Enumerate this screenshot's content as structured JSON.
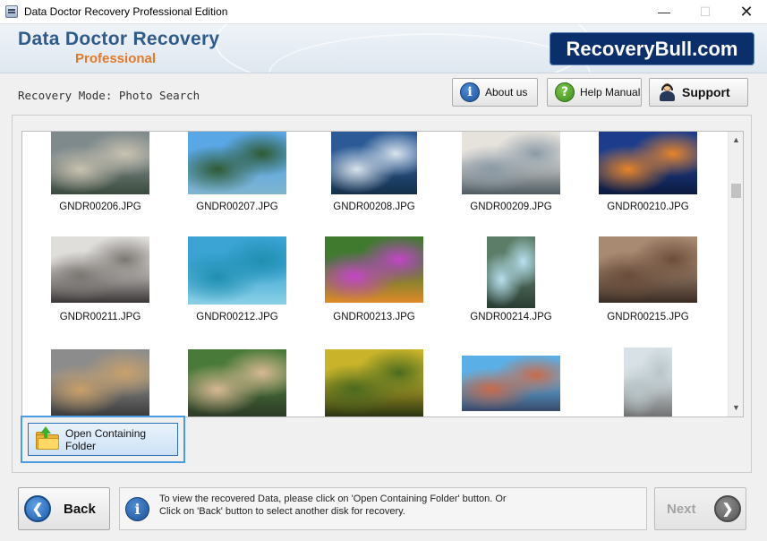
{
  "window": {
    "title": "Data Doctor Recovery Professional Edition",
    "minimize_glyph": "—",
    "maximize_glyph": "☐",
    "close_glyph": "✕"
  },
  "header": {
    "brand_name": "Data Doctor Recovery",
    "brand_edition": "Professional",
    "badge": "RecoveryBull.com"
  },
  "mode_bar": {
    "mode_label": "Recovery Mode: Photo Search",
    "about_label": "About us",
    "about_icon_glyph": "i",
    "help_label": "Help Manual",
    "help_icon_glyph": "?",
    "support_label": "Support"
  },
  "gallery": {
    "photos": [
      {
        "name": "GNDR00206.JPG",
        "icon": "family-lake-photo",
        "colors": [
          "#7e8a8c",
          "#c9c2b0",
          "#3a4a3d"
        ]
      },
      {
        "name": "GNDR00207.JPG",
        "icon": "lake-forest-photo",
        "colors": [
          "#5aa7e6",
          "#2f5a33",
          "#7fb4d0"
        ]
      },
      {
        "name": "GNDR00208.JPG",
        "icon": "winter-lake-photo",
        "colors": [
          "#2b5a96",
          "#d9e3ec",
          "#14304a"
        ]
      },
      {
        "name": "GNDR00209.JPG",
        "icon": "group-meeting-photo",
        "colors": [
          "#e6e2dc",
          "#8a9aa6",
          "#4e5a62"
        ]
      },
      {
        "name": "GNDR00210.JPG",
        "icon": "city-night-photo",
        "colors": [
          "#1d3d8c",
          "#e6842a",
          "#0c1a40"
        ]
      },
      {
        "name": "GNDR00211.JPG",
        "icon": "friends-sofa-photo",
        "colors": [
          "#e0dedb",
          "#7a7672",
          "#3a3636"
        ]
      },
      {
        "name": "GNDR00212.JPG",
        "icon": "tropical-island-photo",
        "colors": [
          "#3ba4d4",
          "#1f8fb0",
          "#8ad0e6"
        ]
      },
      {
        "name": "GNDR00213.JPG",
        "icon": "butterfly-flowers-photo",
        "colors": [
          "#3f7a2e",
          "#c445c8",
          "#e08a2a"
        ]
      },
      {
        "name": "GNDR00214.JPG",
        "icon": "waterfall-photo",
        "colors": [
          "#5c7d68",
          "#b8e0f0",
          "#2a3d33"
        ]
      },
      {
        "name": "GNDR00215.JPG",
        "icon": "friends-rocks-photo",
        "colors": [
          "#a88a72",
          "#6a4c3a",
          "#3a2c24"
        ]
      },
      {
        "name": "",
        "icon": "group-street-photo",
        "colors": [
          "#8c8c8c",
          "#c9a06a",
          "#3a3a3a"
        ]
      },
      {
        "name": "",
        "icon": "friends-selfie-photo",
        "colors": [
          "#4a7a3a",
          "#d8b894",
          "#2c3a26"
        ]
      },
      {
        "name": "",
        "icon": "autumn-tree-photo",
        "colors": [
          "#c9b32a",
          "#4a6a1e",
          "#2a3412"
        ]
      },
      {
        "name": "",
        "icon": "friends-bench-photo",
        "colors": [
          "#5ab0e6",
          "#c96a4a",
          "#3a4a6a"
        ]
      },
      {
        "name": "",
        "icon": "beach-walk-photo",
        "colors": [
          "#d8e2e6",
          "#b8c4c8",
          "#6a6a6a"
        ]
      }
    ]
  },
  "open_folder_label": "Open Containing Folder",
  "footer": {
    "back_label": "Back",
    "back_glyph": "❮",
    "info_icon_glyph": "i",
    "info_line1": "To view the recovered Data, please click on 'Open Containing Folder' button. Or",
    "info_line2": "Click on 'Back' button to select another disk for recovery.",
    "next_label": "Next",
    "next_glyph": "❯"
  }
}
